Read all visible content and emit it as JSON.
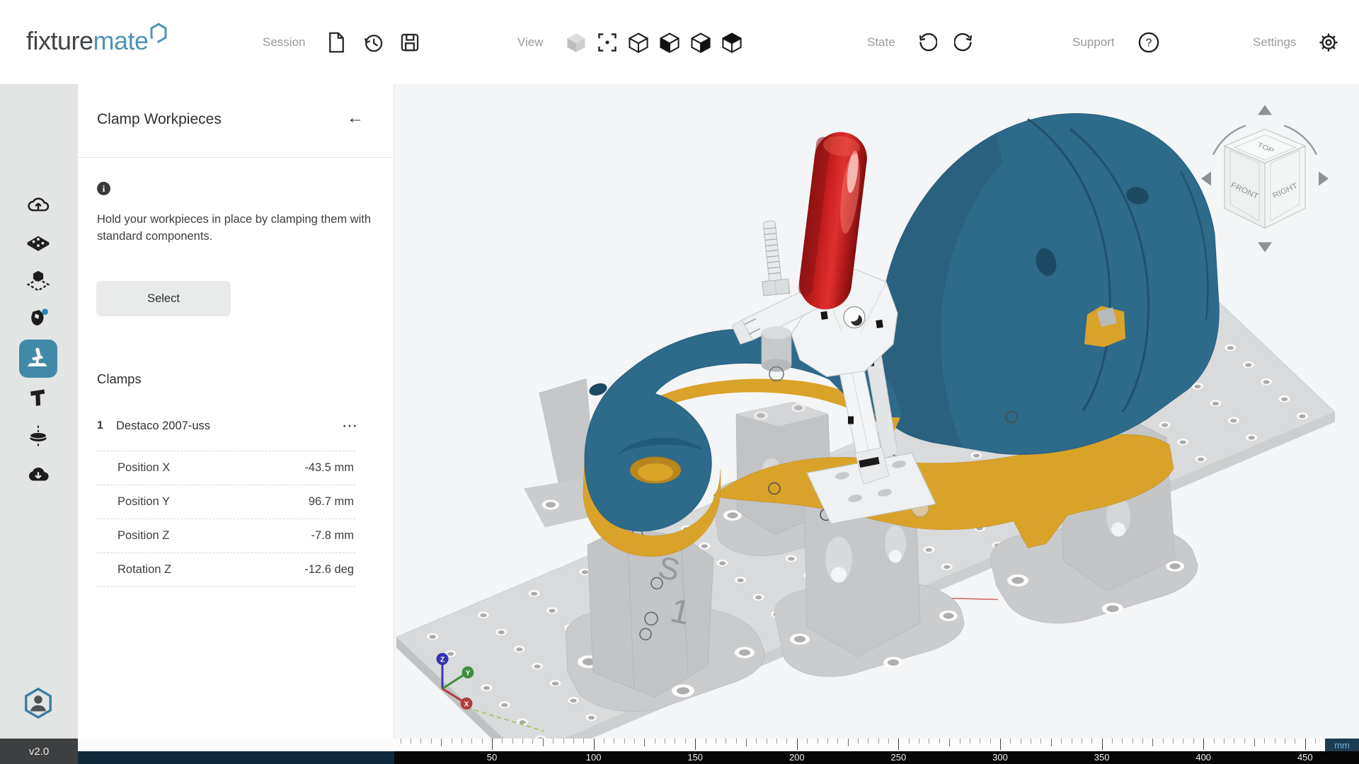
{
  "header": {
    "logo_part1": "fixture",
    "logo_part2": "mate",
    "session_label": "Session",
    "view_label": "View",
    "state_label": "State",
    "support_label": "Support",
    "settings_label": "Settings"
  },
  "sidebar": {
    "version": "v2.0",
    "icons": [
      "cloud-upload",
      "base-plate",
      "workpiece-position",
      "workpiece-part",
      "clamp-tool",
      "cut-tool",
      "probe-disc",
      "cloud-download",
      "user-avatar"
    ]
  },
  "panel": {
    "title": "Clamp Workpieces",
    "back_arrow": "←",
    "description": "Hold your workpieces in place by clamping them with standard components.",
    "select_button": "Select",
    "clamps_heading": "Clamps",
    "clamp": {
      "index": "1",
      "name": "Destaco 2007-uss",
      "menu": "⋯"
    },
    "properties": [
      {
        "label": "Position X",
        "value": "-43.5 mm"
      },
      {
        "label": "Position Y",
        "value": "96.7 mm"
      },
      {
        "label": "Position Z",
        "value": "-7.8 mm"
      },
      {
        "label": "Rotation Z",
        "value": "-12.6 deg"
      }
    ]
  },
  "viewport": {
    "viewcube": {
      "top": "TOP",
      "front": "FRONT",
      "right": "RIGHT"
    },
    "axes": {
      "x": "X",
      "y": "Y",
      "z": "Z"
    },
    "support_tag": {
      "line1": "S",
      "line2": "1"
    },
    "ruler": {
      "unit": "mm",
      "labels": [
        50,
        100,
        150,
        200,
        250,
        300,
        350,
        400,
        450
      ]
    }
  },
  "colors": {
    "brand_teal": "#4f93b7",
    "active_tool": "#4189a8",
    "workpiece_teal": "#2e6a8a",
    "fixture_yellow": "#d9a32a",
    "clamp_red": "#c42020",
    "navy_bar": "#12293b"
  }
}
